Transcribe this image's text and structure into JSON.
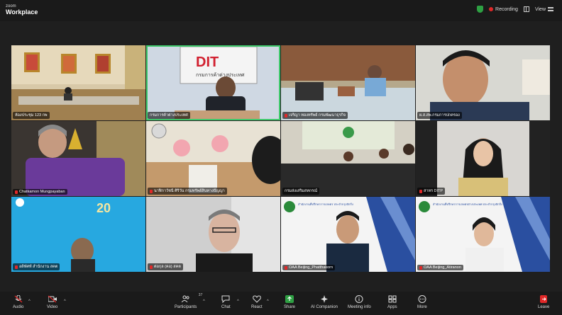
{
  "app": {
    "logo_line1": "zoom",
    "logo_line2": "Workplace"
  },
  "top_bar": {
    "recording_label": "Recording",
    "view_label": "View",
    "shield_color": "#2ea043",
    "record_color": "#e02828"
  },
  "tiles": [
    {
      "name": "ห้องประชุม 123 กพ",
      "muted": false
    },
    {
      "name": "กรมการค้าต่างประเทศ",
      "muted": false,
      "active": true
    },
    {
      "name": "เจริญา ทองทรัพย์ กรมพัฒนาธุรกิจ",
      "muted": true
    },
    {
      "name": "ผ.ส.สพ.กรมการปกครอง",
      "muted": false
    },
    {
      "name": "Chatkamon Mungpayaban",
      "muted": true
    },
    {
      "name": "นาฬิกาวัชนี ศิริวัน กรมทรัพย์สินทางปัญญา",
      "muted": true
    },
    {
      "name": "กรมส่งเสริมสหกรณ์",
      "muted": false
    },
    {
      "name": "สาหร DITP",
      "muted": true
    },
    {
      "name": "อดิพัศท์ สำนักงาน สคต",
      "muted": true
    },
    {
      "name": "ต่อกุล (คอ) สคต",
      "muted": true
    },
    {
      "name": "OAA Beijing_Phatthakorn",
      "muted": true
    },
    {
      "name": "OAA Beijing_Atiranon",
      "muted": true
    }
  ],
  "tile_text": {
    "dit_logo": "DIT",
    "dit_sub": "กรมการค้าต่างประเทศ",
    "office_header": "สำนักงานที่ปรึกษาการเกษตร ประจำกรุงปักกิ่ง",
    "office_header2": "สำนักงานที่ปรึกษาการเกษตรต่างประเทศ ประจำกรุงปักกิ่ง",
    "anniv": "20"
  },
  "controls": [
    {
      "label": "Audio",
      "icon": "microphone-icon",
      "caret": true
    },
    {
      "label": "Video",
      "icon": "video-camera-icon",
      "caret": true
    },
    {
      "label": "Participants",
      "icon": "participants-icon",
      "count": "37",
      "caret": true
    },
    {
      "label": "Chat",
      "icon": "chat-icon",
      "caret": true
    },
    {
      "label": "React",
      "icon": "heart-icon",
      "caret": true
    },
    {
      "label": "Share",
      "icon": "share-icon",
      "caret": false
    },
    {
      "label": "AI Companion",
      "icon": "ai-sparkle-icon",
      "caret": false
    },
    {
      "label": "Meeting info",
      "icon": "info-icon",
      "caret": false
    },
    {
      "label": "Apps",
      "icon": "apps-icon",
      "caret": false
    },
    {
      "label": "More",
      "icon": "more-icon",
      "caret": false
    },
    {
      "label": "Leave",
      "icon": "leave-icon",
      "caret": false
    }
  ]
}
